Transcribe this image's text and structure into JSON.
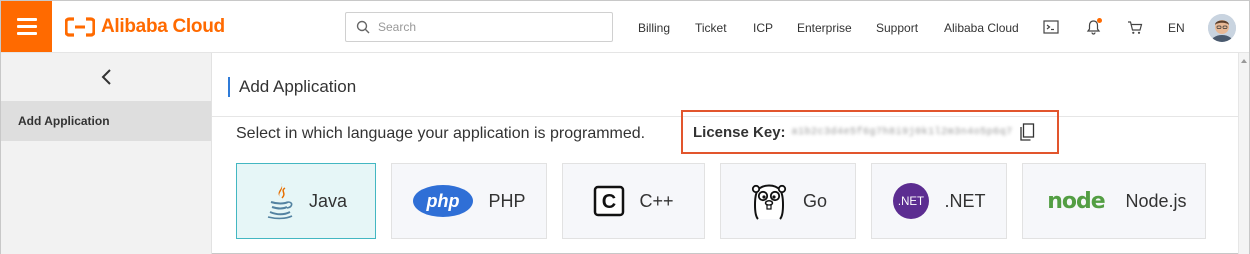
{
  "header": {
    "brand": "Alibaba Cloud",
    "search_placeholder": "Search",
    "nav": [
      "Billing",
      "Ticket",
      "ICP",
      "Enterprise",
      "Support",
      "Alibaba Cloud"
    ],
    "language": "EN",
    "accent_color": "#ff6a00"
  },
  "sidebar": {
    "items": [
      {
        "label": "Add Application",
        "active": true
      }
    ]
  },
  "main": {
    "title": "Add Application",
    "prompt": "Select in which language your application is programmed.",
    "license_label": "License Key:",
    "license_value": "a1b2c3d4e5f6g7h8i9j0k1l2m3n4o5p6q7",
    "languages": [
      {
        "label": "Java",
        "icon": "java-icon",
        "selected": true
      },
      {
        "label": "PHP",
        "icon": "php-icon",
        "selected": false
      },
      {
        "label": "C++",
        "icon": "cpp-icon",
        "selected": false
      },
      {
        "label": "Go",
        "icon": "go-gopher-icon",
        "selected": false
      },
      {
        "label": ".NET",
        "icon": "dotnet-icon",
        "selected": false
      },
      {
        "label": "Node.js",
        "icon": "nodejs-icon",
        "selected": false
      }
    ],
    "icon_texts": {
      "php": "php",
      "cpp": "C",
      "dotnet": ".NET",
      "node": "node"
    }
  }
}
